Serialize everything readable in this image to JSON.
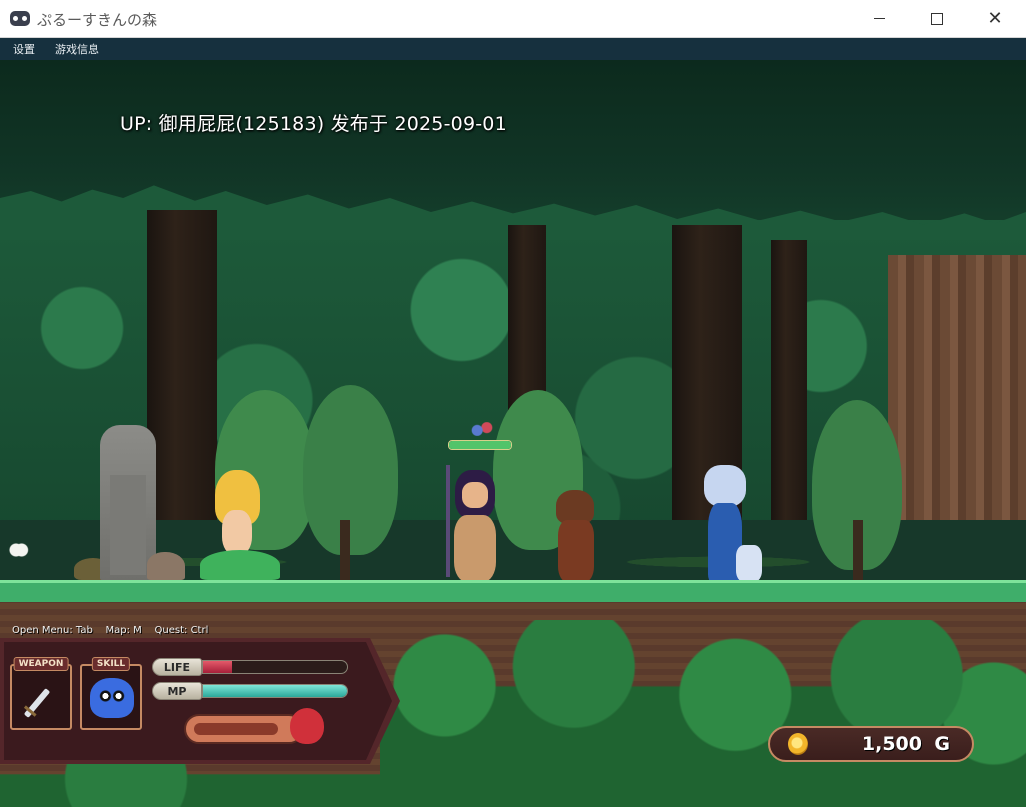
{
  "window": {
    "title": "ぷるーすきんの森",
    "controls": [
      "minimize",
      "maximize",
      "close"
    ]
  },
  "menubar": {
    "items": [
      {
        "label": "设置"
      },
      {
        "label": "游戏信息"
      }
    ]
  },
  "overlay": {
    "upload_caption": "UP: 御用屁屁(125183) 发布于 2025-09-01"
  },
  "hud": {
    "controls_hint": "Open Menu: Tab    Map: M    Quest: Ctrl",
    "weapon_slot_label": "WEAPON",
    "weapon_icon": "sword-icon",
    "skill_slot_label": "SKILL",
    "skill_icon": "blue-slime-icon",
    "life_label": "LIFE",
    "life_fraction": 0.2,
    "mp_label": "MP",
    "mp_fraction": 1.0,
    "gold_amount": "1,500",
    "gold_unit": "G",
    "gold_icon": "coin-icon"
  },
  "enemy": {
    "health_fraction": 1.0
  },
  "colors": {
    "life_bar": "#c8304a",
    "mp_bar": "#4fd0c0",
    "hud_frame": "#c58a63",
    "grass": "#3fae6a"
  }
}
